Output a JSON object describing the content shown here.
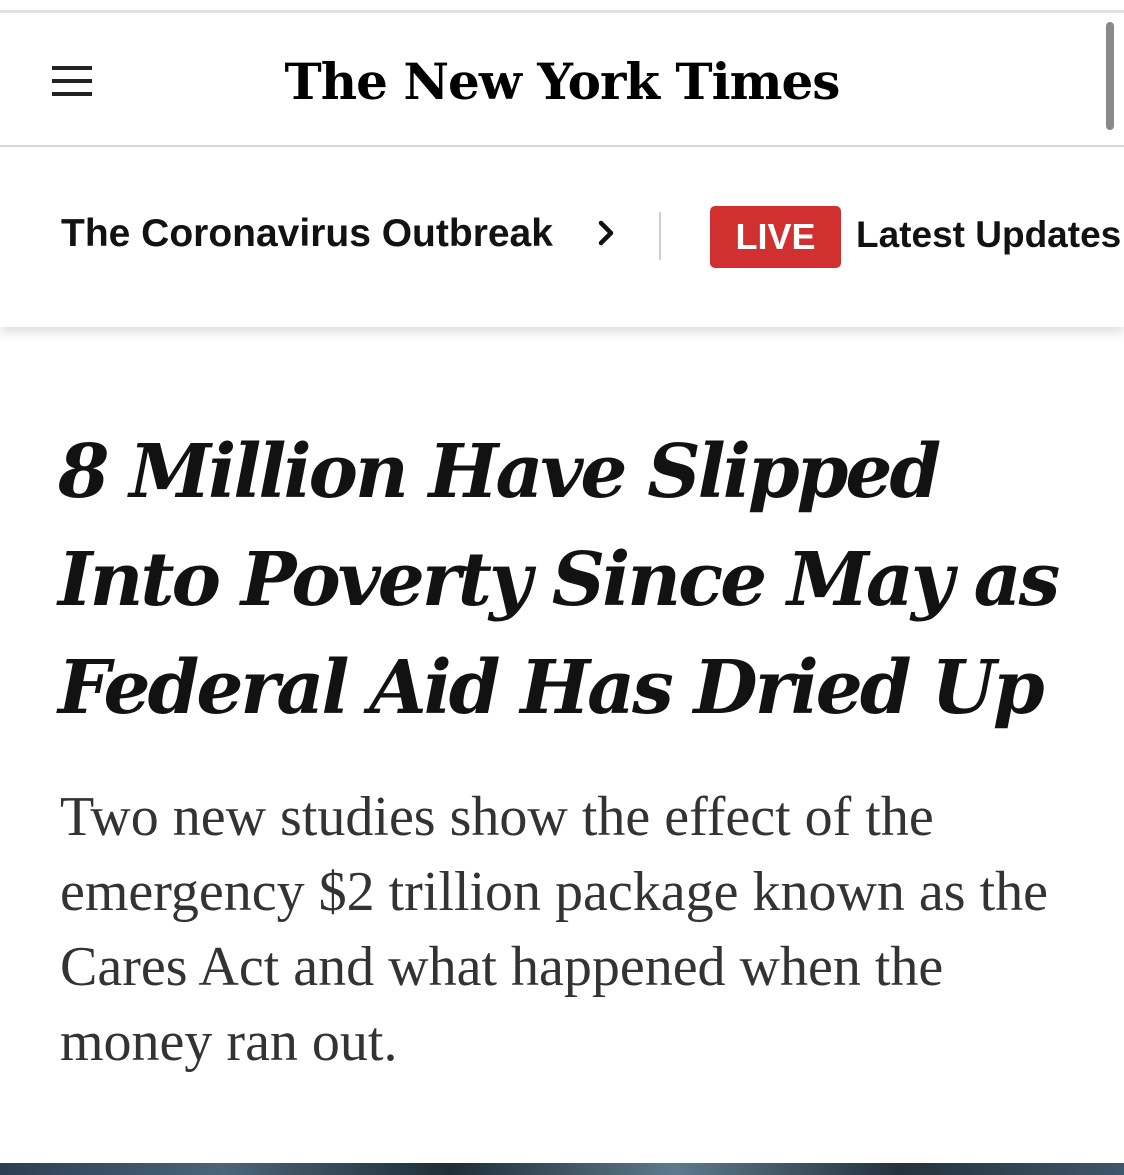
{
  "header": {
    "logo_text": "The New York Times",
    "menu_icon": "hamburger-menu-icon"
  },
  "nav": {
    "section_label": "The Coronavirus Outbreak",
    "section_chevron_icon": "chevron-right-icon",
    "live_label": "LIVE",
    "live_color": "#d0302f",
    "latest_label": "Latest Updates"
  },
  "article": {
    "headline": "8 Million Have Slipped Into Poverty Since May as Federal Aid Has Dried Up",
    "summary": "Two new studies show the effect of the emergency $2 trillion package known as the Cares Act and what happened when the money ran out."
  }
}
